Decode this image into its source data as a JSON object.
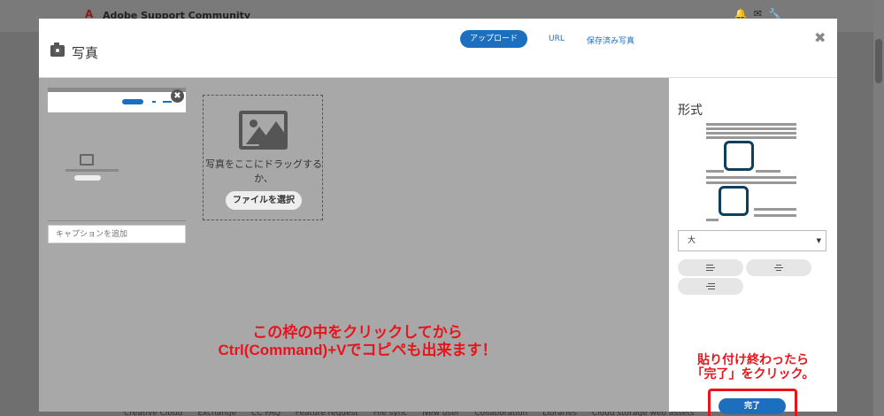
{
  "background": {
    "site_title": "Adobe Support Community",
    "footer_links": [
      "Creative Cloud",
      "Exchange",
      "CC FAQ",
      "Feature request",
      "File sync",
      "New user",
      "Collaboration",
      "Libraries",
      "Cloud storage web assets"
    ]
  },
  "modal": {
    "title": "写真",
    "tabs": {
      "upload": "アップロード",
      "url": "URL",
      "saved": "保存済み写真"
    },
    "close": "✖",
    "caption_placeholder": "キャプションを追加",
    "dropzone": {
      "text": "写真をここにドラッグするか、",
      "button": "ファイルを選択"
    },
    "sidebar": {
      "format_title": "形式",
      "size_value": "大",
      "done_label": "完了"
    }
  },
  "annotations": {
    "main_line1": "この枠の中をクリックしてから",
    "main_line2": "Ctrl(Command)+Vでコピペも出来ます！",
    "side_line1": "貼り付け終わったら",
    "side_line2": "「完了」をクリック。"
  },
  "colors": {
    "accent": "#1b6fbe",
    "annotation": "#e8141c",
    "frame": "#0e3e5e"
  }
}
